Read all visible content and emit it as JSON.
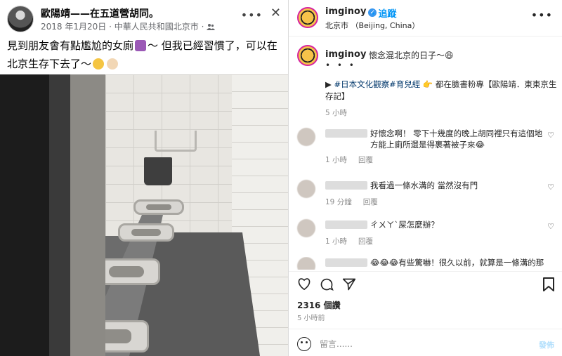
{
  "facebook_post": {
    "author": "歐陽靖——在五道營胡同。",
    "date": "2018 年1月20日",
    "location": "中華人民共和國北京市",
    "text_line1": "見到朋友會有點尷尬的女廁",
    "text_line1_after": "～ 但我已經習慣了，可以在",
    "text_line2": "北京生存下去了～",
    "more_glyph": "•••",
    "close_glyph": "✕"
  },
  "instagram": {
    "username": "imginoy",
    "follow_label": "追蹤",
    "location": "北京市 （Beijing, China）",
    "more_glyph": "•••",
    "caption": {
      "username": "imginoy",
      "text": "懷念混北京的日子～😆",
      "dots": "• • •",
      "tags_prefix": "▶ ",
      "tag1": "#日本文化觀察",
      "tag2": "#育兒經",
      "tags_suffix": " 👉 都在臉書粉專【歐陽靖．東東京生存記】",
      "time": "5 小時"
    },
    "comments": [
      {
        "text": "好懷念啊！ 零下十幾度的晚上胡同裡只有這個地方能上廁所還是得裹著被子來😂",
        "time": "1 小時",
        "reply": "回覆"
      },
      {
        "text": "我看過一條水溝的 當然沒有門",
        "time": "19 分鐘",
        "reply": "回覆"
      },
      {
        "text": "ㄔㄨㄚˋ屎怎麼辦？",
        "time": "1 小時",
        "reply": "回覆"
      },
      {
        "text": "😂😂😂有些驚嚇！很久以前，就算是一條溝的那",
        "time": "",
        "reply": ""
      }
    ],
    "likes": "2316 個讚",
    "post_time": "5 小時前",
    "comment_placeholder": "留言......",
    "post_label": "發佈",
    "heart_glyph": "♡"
  },
  "colors": {
    "ig_link": "#0095f6",
    "ig_verified": "#3897f0",
    "ig_tag": "#00376b",
    "fb_meta": "#65676b"
  },
  "icons": {
    "fb": [
      "avatar",
      "people-icon",
      "more-icon",
      "close-icon"
    ],
    "ig": [
      "verified-icon",
      "heart-icon",
      "comment-icon",
      "share-icon",
      "bookmark-icon",
      "emoji-icon"
    ]
  }
}
